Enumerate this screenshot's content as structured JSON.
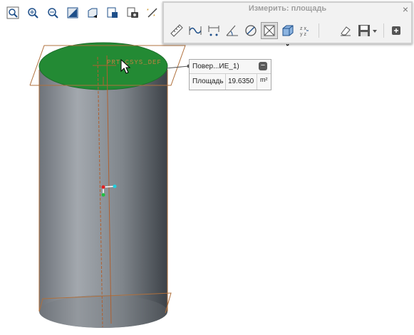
{
  "measure_panel": {
    "title": "Измерить: площадь",
    "close_glyph": "×",
    "tools": [
      "ruler-icon",
      "curve-length-icon",
      "distance-icon",
      "angle-icon",
      "diameter-icon",
      "area-icon",
      "volume-icon",
      "transform-icon",
      "eraser-icon",
      "save-icon",
      "add-icon"
    ],
    "active_tool": "area-icon"
  },
  "view_toolbar": {
    "tools": [
      "zoom-fit-icon",
      "zoom-in-icon",
      "zoom-out-icon",
      "view-style-icon",
      "saved-views-icon",
      "named-views-icon",
      "screenshot-icon",
      "display-toggle-icon"
    ]
  },
  "callout": {
    "title": "Повер...ИЕ_1)",
    "collapse_glyph": "−",
    "label": "Площадь",
    "value": "19.6350",
    "unit": "m²"
  },
  "model": {
    "top_face_label": "PRT_CSYS_DEF",
    "colors": {
      "top_face": "#238a34",
      "body_dark": "#3c4147",
      "body_light": "#a3a8ae",
      "edges": "#b0703c",
      "datum": "#b06030"
    }
  }
}
